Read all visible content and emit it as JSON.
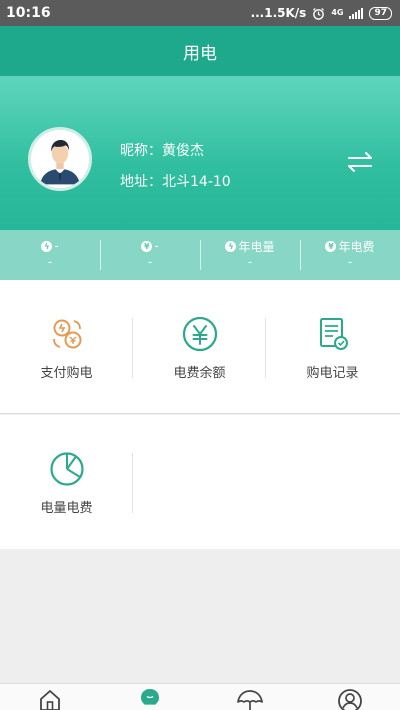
{
  "status_bar": {
    "time": "10:16",
    "network_speed": "...1.5K/s",
    "network_type": "4G",
    "battery": "97"
  },
  "header": {
    "title": "用电"
  },
  "profile": {
    "nickname_label": "昵称：",
    "nickname": "黄俊杰",
    "address_label": "地址：",
    "address": "北斗14-10"
  },
  "stats": [
    {
      "icon": "kwh-icon",
      "label": "-",
      "value": "-"
    },
    {
      "icon": "yuan-icon",
      "label": "-",
      "value": "-"
    },
    {
      "icon": "kwh-icon",
      "label": "年电量",
      "value": "-"
    },
    {
      "icon": "yuan-icon",
      "label": "年电费",
      "value": "-"
    }
  ],
  "menu": [
    {
      "label": "支付购电",
      "icon": "pay-exchange-icon"
    },
    {
      "label": "电费余额",
      "icon": "yuan-circle-icon"
    },
    {
      "label": "购电记录",
      "icon": "record-document-icon"
    },
    {
      "label": "电量电费",
      "icon": "pie-chart-icon"
    }
  ],
  "bottom_nav": [
    {
      "name": "home",
      "icon": "home-icon",
      "active": false
    },
    {
      "name": "electricity",
      "icon": "bulb-icon",
      "active": true
    },
    {
      "name": "umbrella",
      "icon": "umbrella-icon",
      "active": false
    },
    {
      "name": "profile",
      "icon": "user-icon",
      "active": false
    }
  ],
  "colors": {
    "primary": "#1ea88c",
    "header_gradient_top": "#5fd5bd",
    "stats_bar": "#88d6c6",
    "icon_orange": "#e69a55",
    "icon_green": "#2aa98c"
  }
}
